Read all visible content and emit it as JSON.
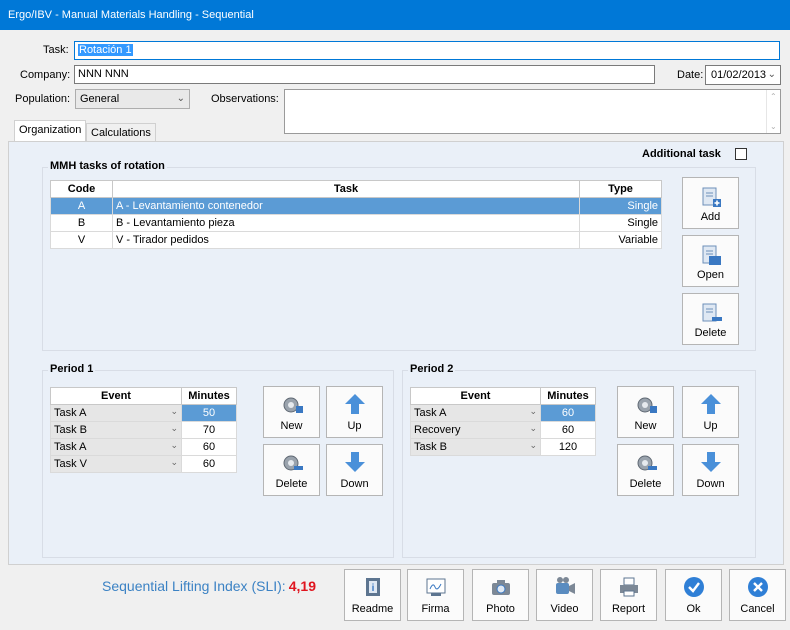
{
  "window": {
    "title": "Ergo/IBV - Manual Materials Handling - Sequential"
  },
  "form": {
    "task_label": "Task:",
    "task_value": "Rotación 1",
    "company_label": "Company:",
    "company_value": "NNN NNN",
    "date_label": "Date:",
    "date_value": "01/02/2013",
    "population_label": "Population:",
    "population_value": "General",
    "observations_label": "Observations:",
    "observations_value": ""
  },
  "tabs": [
    {
      "label": "Organization",
      "active": true
    },
    {
      "label": "Calculations",
      "active": false
    }
  ],
  "additional_task": {
    "label": "Additional task",
    "checked": false
  },
  "mmh": {
    "title": "MMH tasks of rotation",
    "columns": [
      "Code",
      "Task",
      "Type"
    ],
    "rows": [
      {
        "code": "A",
        "task": "A - Levantamiento contenedor",
        "type": "Single",
        "selected": true
      },
      {
        "code": "B",
        "task": "B - Levantamiento pieza",
        "type": "Single",
        "selected": false
      },
      {
        "code": "V",
        "task": "V - Tirador pedidos",
        "type": "Variable",
        "selected": false
      }
    ],
    "buttons": {
      "add": "Add",
      "open": "Open",
      "delete": "Delete"
    }
  },
  "period1": {
    "title": "Period 1",
    "columns": [
      "Event",
      "Minutes"
    ],
    "rows": [
      {
        "event": "Task A",
        "minutes": "50",
        "selected": true
      },
      {
        "event": "Task B",
        "minutes": "70",
        "selected": false
      },
      {
        "event": "Task A",
        "minutes": "60",
        "selected": false
      },
      {
        "event": "Task V",
        "minutes": "60",
        "selected": false
      }
    ],
    "buttons": {
      "new": "New",
      "up": "Up",
      "delete": "Delete",
      "down": "Down"
    }
  },
  "period2": {
    "title": "Period 2",
    "columns": [
      "Event",
      "Minutes"
    ],
    "rows": [
      {
        "event": "Task A",
        "minutes": "60",
        "selected": true
      },
      {
        "event": "Recovery",
        "minutes": "60",
        "selected": false
      },
      {
        "event": "Task B",
        "minutes": "120",
        "selected": false
      }
    ],
    "buttons": {
      "new": "New",
      "up": "Up",
      "delete": "Delete",
      "down": "Down"
    }
  },
  "footer": {
    "sli_label": "Sequential Lifting Index (SLI):",
    "sli_value": "4,19",
    "buttons": {
      "readme": "Readme",
      "firma": "Firma",
      "photo": "Photo",
      "video": "Video",
      "report": "Report",
      "ok": "Ok",
      "cancel": "Cancel"
    }
  },
  "colors": {
    "titlebar": "#0078d7",
    "selection": "#5b9bd5",
    "panel": "#eaf0f8",
    "sli_label": "#3b82c4",
    "sli_value": "#e0141e",
    "ok_icon": "#2f7fd6"
  }
}
